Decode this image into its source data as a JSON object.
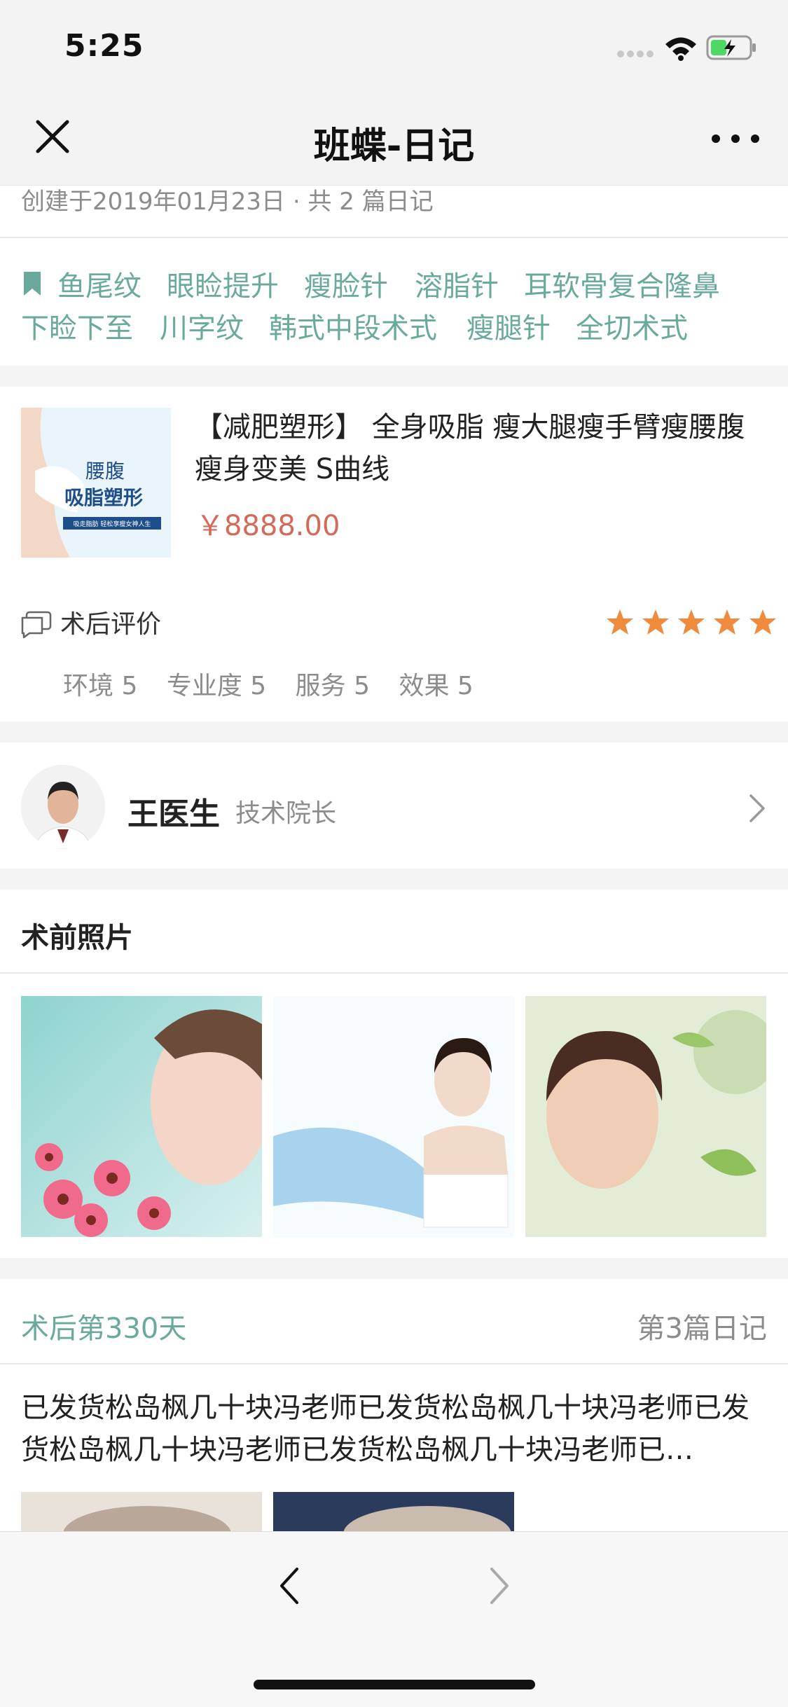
{
  "status_bar": {
    "time": "5:25"
  },
  "nav": {
    "title": "班蝶-日记"
  },
  "summary": {
    "created_text": "创建于2019年01月23日 · 共 2 篇日记"
  },
  "tags": [
    "鱼尾纹",
    "眼睑提升",
    "瘦脸针",
    "溶脂针",
    "耳软骨复合隆鼻",
    "下睑下至",
    "川字纹",
    "韩式中段术式",
    "瘦腿针",
    "全切术式"
  ],
  "product": {
    "title": "【减肥塑形】 全身吸脂 瘦大腿瘦手臂瘦腰腹 瘦身变美 S曲线",
    "price": "￥8888.00",
    "image_text": {
      "line1": "腰腹",
      "line2": "吸脂塑形",
      "line3": "吸走脂肪 轻松享瘦女神人生"
    }
  },
  "review": {
    "label": "术后评价",
    "stars": 5,
    "scores": [
      {
        "label": "环境 5"
      },
      {
        "label": "专业度 5"
      },
      {
        "label": "服务 5"
      },
      {
        "label": "效果 5"
      }
    ]
  },
  "doctor": {
    "name": "王医生",
    "title": "技术院长"
  },
  "pre_photos": {
    "title": "术前照片"
  },
  "diary": {
    "day": "术后第330天",
    "index": "第3篇日记",
    "text": "已发货松岛枫几十块冯老师已发货松岛枫几十块冯老师已发货松岛枫几十块冯老师已发货松岛枫几十块冯老师已…"
  },
  "colors": {
    "accent": "#6aaa9d",
    "price": "#d46b5a",
    "star": "#f08a3c"
  }
}
